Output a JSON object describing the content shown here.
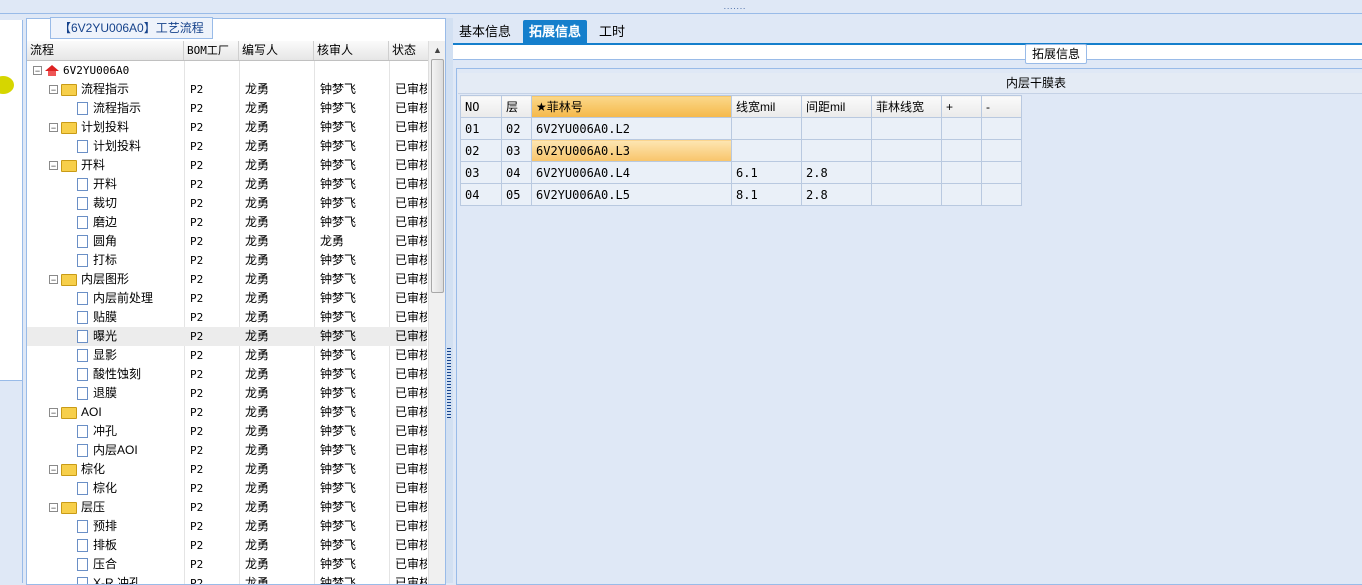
{
  "topbar": {
    "handle": "......."
  },
  "middle_panel": {
    "title": "【6V2YU006A0】工艺流程",
    "columns": [
      "流程",
      "BOM工厂",
      "编写人",
      "核审人",
      "状态"
    ],
    "rows": [
      {
        "label": "6V2YU006A0",
        "level": 0,
        "type": "root",
        "bom": "",
        "writer": "",
        "reviewer": "",
        "status": ""
      },
      {
        "label": "流程指示",
        "level": 1,
        "type": "folder",
        "bom": "P2",
        "writer": "龙勇",
        "reviewer": "钟梦飞",
        "status": "已审核"
      },
      {
        "label": "流程指示",
        "level": 2,
        "type": "doc",
        "bom": "P2",
        "writer": "龙勇",
        "reviewer": "钟梦飞",
        "status": "已审核"
      },
      {
        "label": "计划投料",
        "level": 1,
        "type": "folder",
        "bom": "P2",
        "writer": "龙勇",
        "reviewer": "钟梦飞",
        "status": "已审核"
      },
      {
        "label": "计划投料",
        "level": 2,
        "type": "doc",
        "bom": "P2",
        "writer": "龙勇",
        "reviewer": "钟梦飞",
        "status": "已审核"
      },
      {
        "label": "开料",
        "level": 1,
        "type": "folder",
        "bom": "P2",
        "writer": "龙勇",
        "reviewer": "钟梦飞",
        "status": "已审核"
      },
      {
        "label": "开料",
        "level": 2,
        "type": "doc",
        "bom": "P2",
        "writer": "龙勇",
        "reviewer": "钟梦飞",
        "status": "已审核"
      },
      {
        "label": "裁切",
        "level": 2,
        "type": "doc",
        "bom": "P2",
        "writer": "龙勇",
        "reviewer": "钟梦飞",
        "status": "已审核"
      },
      {
        "label": "磨边",
        "level": 2,
        "type": "doc",
        "bom": "P2",
        "writer": "龙勇",
        "reviewer": "钟梦飞",
        "status": "已审核"
      },
      {
        "label": "圆角",
        "level": 2,
        "type": "doc",
        "bom": "P2",
        "writer": "龙勇",
        "reviewer": "龙勇",
        "status": "已审核"
      },
      {
        "label": "打标",
        "level": 2,
        "type": "doc",
        "bom": "P2",
        "writer": "龙勇",
        "reviewer": "钟梦飞",
        "status": "已审核"
      },
      {
        "label": "内层图形",
        "level": 1,
        "type": "folder",
        "bom": "P2",
        "writer": "龙勇",
        "reviewer": "钟梦飞",
        "status": "已审核"
      },
      {
        "label": "内层前处理",
        "level": 2,
        "type": "doc",
        "bom": "P2",
        "writer": "龙勇",
        "reviewer": "钟梦飞",
        "status": "已审核"
      },
      {
        "label": "贴膜",
        "level": 2,
        "type": "doc",
        "bom": "P2",
        "writer": "龙勇",
        "reviewer": "钟梦飞",
        "status": "已审核"
      },
      {
        "label": "曝光",
        "level": 2,
        "type": "doc",
        "bom": "P2",
        "writer": "龙勇",
        "reviewer": "钟梦飞",
        "status": "已审核",
        "selected": true
      },
      {
        "label": "显影",
        "level": 2,
        "type": "doc",
        "bom": "P2",
        "writer": "龙勇",
        "reviewer": "钟梦飞",
        "status": "已审核"
      },
      {
        "label": "酸性蚀刻",
        "level": 2,
        "type": "doc",
        "bom": "P2",
        "writer": "龙勇",
        "reviewer": "钟梦飞",
        "status": "已审核"
      },
      {
        "label": "退膜",
        "level": 2,
        "type": "doc",
        "bom": "P2",
        "writer": "龙勇",
        "reviewer": "钟梦飞",
        "status": "已审核"
      },
      {
        "label": "AOI",
        "level": 1,
        "type": "folder",
        "bom": "P2",
        "writer": "龙勇",
        "reviewer": "钟梦飞",
        "status": "已审核"
      },
      {
        "label": "冲孔",
        "level": 2,
        "type": "doc",
        "bom": "P2",
        "writer": "龙勇",
        "reviewer": "钟梦飞",
        "status": "已审核"
      },
      {
        "label": "内层AOI",
        "level": 2,
        "type": "doc",
        "bom": "P2",
        "writer": "龙勇",
        "reviewer": "钟梦飞",
        "status": "已审核"
      },
      {
        "label": "棕化",
        "level": 1,
        "type": "folder",
        "bom": "P2",
        "writer": "龙勇",
        "reviewer": "钟梦飞",
        "status": "已审核"
      },
      {
        "label": "棕化",
        "level": 2,
        "type": "doc",
        "bom": "P2",
        "writer": "龙勇",
        "reviewer": "钟梦飞",
        "status": "已审核"
      },
      {
        "label": "层压",
        "level": 1,
        "type": "folder",
        "bom": "P2",
        "writer": "龙勇",
        "reviewer": "钟梦飞",
        "status": "已审核"
      },
      {
        "label": "预排",
        "level": 2,
        "type": "doc",
        "bom": "P2",
        "writer": "龙勇",
        "reviewer": "钟梦飞",
        "status": "已审核"
      },
      {
        "label": "排板",
        "level": 2,
        "type": "doc",
        "bom": "P2",
        "writer": "龙勇",
        "reviewer": "钟梦飞",
        "status": "已审核"
      },
      {
        "label": "压合",
        "level": 2,
        "type": "doc",
        "bom": "P2",
        "writer": "龙勇",
        "reviewer": "钟梦飞",
        "status": "已审核"
      },
      {
        "label": "X-R 冲孔",
        "level": 2,
        "type": "doc",
        "bom": "P2",
        "writer": "龙勇",
        "reviewer": "钟梦飞",
        "status": "已审核"
      }
    ]
  },
  "right_panel": {
    "tabs": [
      {
        "label": "基本信息",
        "active": false
      },
      {
        "label": "拓展信息",
        "active": true
      },
      {
        "label": "工时",
        "active": false
      }
    ],
    "fieldset_legend": "拓展信息",
    "table_title": "内层干膜表",
    "columns": [
      "NO",
      "层",
      "★菲林号",
      "线宽mil",
      "间距mil",
      "菲林线宽",
      "+",
      "-"
    ],
    "rows": [
      {
        "no": "01",
        "layer": "02",
        "film": "6V2YU006A0.L2",
        "width": "",
        "spacing": "",
        "film_width": ""
      },
      {
        "no": "02",
        "layer": "03",
        "film": "6V2YU006A0.L3",
        "width": "",
        "spacing": "",
        "film_width": "",
        "selected": true
      },
      {
        "no": "03",
        "layer": "04",
        "film": "6V2YU006A0.L4",
        "width": "6.1",
        "spacing": "2.8",
        "film_width": ""
      },
      {
        "no": "04",
        "layer": "05",
        "film": "6V2YU006A0.L5",
        "width": "8.1",
        "spacing": "2.8",
        "film_width": ""
      }
    ]
  },
  "colors": {
    "accent": "#157fcc",
    "border": "#99bbe8",
    "selection": "#f8c46a"
  }
}
